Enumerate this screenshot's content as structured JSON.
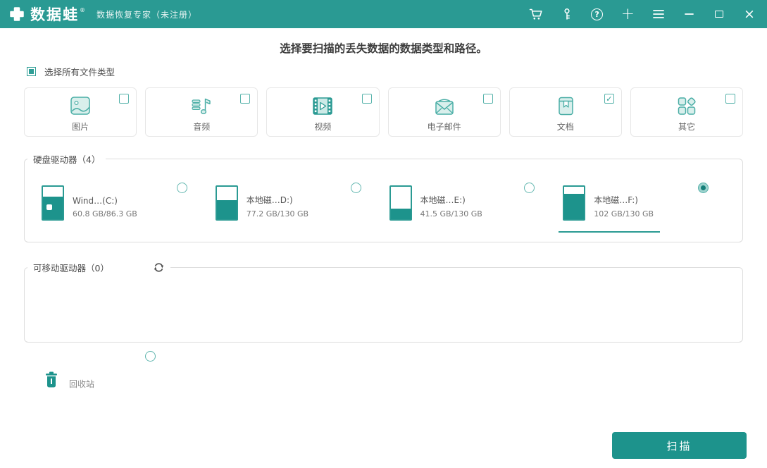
{
  "titlebar": {
    "app_name": "数据蛙",
    "registered_mark": "®",
    "subtitle": "数据恢复专家（未注册）",
    "icon_names": [
      "cart-icon",
      "key-icon",
      "help-icon",
      "plus-icon",
      "menu-icon",
      "minimize-icon",
      "maximize-icon",
      "close-icon"
    ],
    "glyphs": {
      "help": "?",
      "plus": "+",
      "close": "×"
    }
  },
  "main": {
    "heading": "选择要扫描的丢失数据的数据类型和路径。",
    "select_all": {
      "label": "选择所有文件类型",
      "indeterminate": true
    },
    "file_types": [
      {
        "label": "图片",
        "icon": "image-icon",
        "checked": false
      },
      {
        "label": "音频",
        "icon": "audio-icon",
        "checked": false
      },
      {
        "label": "视频",
        "icon": "video-icon",
        "checked": false
      },
      {
        "label": "电子邮件",
        "icon": "email-icon",
        "checked": false
      },
      {
        "label": "文档",
        "icon": "document-icon",
        "checked": true
      },
      {
        "label": "其它",
        "icon": "other-icon",
        "checked": false
      }
    ],
    "hard_drives": {
      "title": "硬盘驱动器（4）",
      "drives": [
        {
          "name": "Wind…(C:)",
          "capacity": "60.8 GB/86.3 GB",
          "fill_percent": 70,
          "selected": false,
          "has_windows_badge": true
        },
        {
          "name": "本地磁…D:)",
          "capacity": "77.2 GB/130 GB",
          "fill_percent": 59,
          "selected": false,
          "has_windows_badge": false
        },
        {
          "name": "本地磁…E:)",
          "capacity": "41.5 GB/130 GB",
          "fill_percent": 32,
          "selected": false,
          "has_windows_badge": false
        },
        {
          "name": "本地磁…F:)",
          "capacity": "102 GB/130 GB",
          "fill_percent": 78,
          "selected": true,
          "has_windows_badge": false
        }
      ]
    },
    "removable_drives": {
      "title": "可移动驱动器（0）",
      "refresh_icon": "refresh-icon"
    },
    "recycle_bin": {
      "label": "回收站",
      "selected": false,
      "icon": "trash-icon"
    },
    "scan_button_label": "扫描"
  },
  "colors": {
    "accent": "#2a9a93",
    "accent_dark": "#1d938c",
    "icon_stroke": "#49ada5",
    "icon_fill": "#d9efec"
  }
}
